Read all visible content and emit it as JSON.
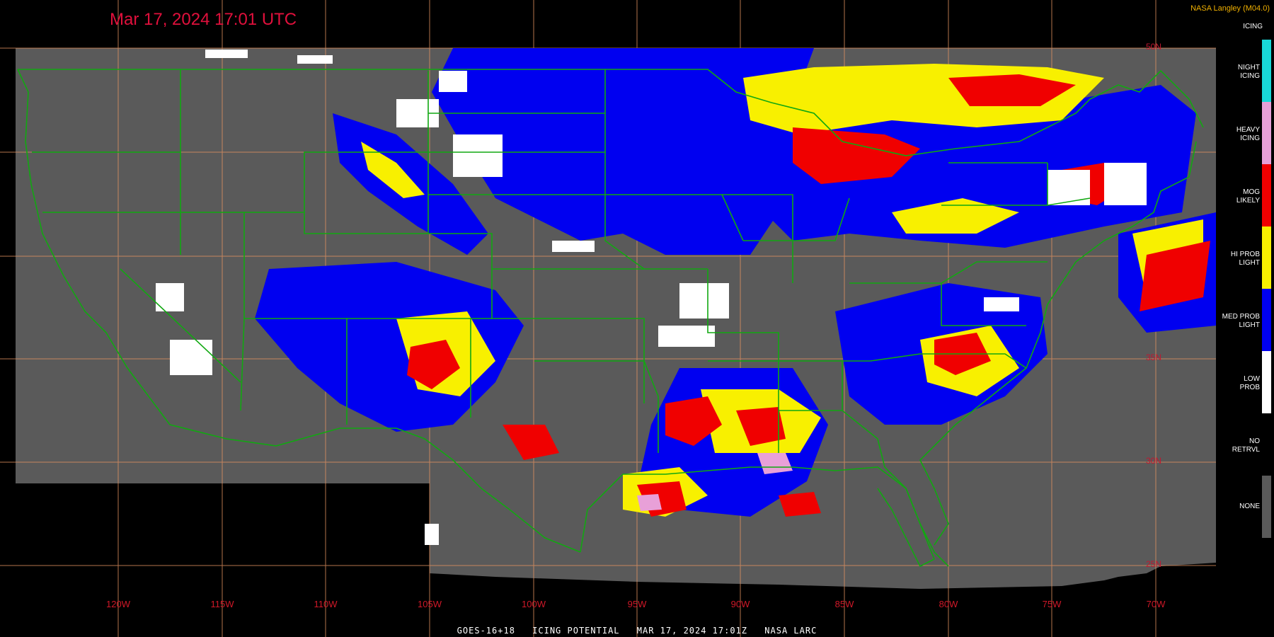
{
  "timestamp": "Mar 17, 2024 17:01 UTC",
  "credit": "NASA Langley (M04.0)",
  "footer": {
    "satellite": "GOES-16+18",
    "product": "ICING POTENTIAL",
    "time": "MAR 17, 2024 17:01Z",
    "org": "NASA LARC"
  },
  "legend": {
    "title": "ICING",
    "items": [
      {
        "label1": "NIGHT",
        "label2": "ICING",
        "color": "#18d8d8",
        "icon": "night-icing"
      },
      {
        "label1": "HEAVY",
        "label2": "ICING",
        "color": "#e8a0d8",
        "icon": "heavy-icing"
      },
      {
        "label1": "MOG",
        "label2": "LIKELY",
        "color": "#f00000",
        "icon": "mog-likely"
      },
      {
        "label1": "HI PROB",
        "label2": "LIGHT",
        "color": "#f8f000",
        "icon": "hi-prob-light"
      },
      {
        "label1": "MED PROB",
        "label2": "LIGHT",
        "color": "#0000f0",
        "icon": "med-prob-light"
      },
      {
        "label1": "LOW",
        "label2": "PROB",
        "color": "#ffffff",
        "icon": "low-prob"
      },
      {
        "label1": "NO",
        "label2": "RETRVL",
        "color": "#000000",
        "icon": "no-retrieval"
      },
      {
        "label1": "NONE",
        "label2": "",
        "color": "#5a5a5a",
        "icon": "none"
      }
    ]
  },
  "longitudes": [
    "120W",
    "115W",
    "110W",
    "105W",
    "100W",
    "95W",
    "90W",
    "85W",
    "80W",
    "75W",
    "70W"
  ],
  "latitudes": [
    "50N",
    "35N",
    "30N",
    "25N"
  ],
  "colors": {
    "background": "#000000",
    "no_data_gray": "#5a5a5a",
    "border_green": "#11a811",
    "grid": "#e09060",
    "timestamp_red": "#e0103c"
  }
}
